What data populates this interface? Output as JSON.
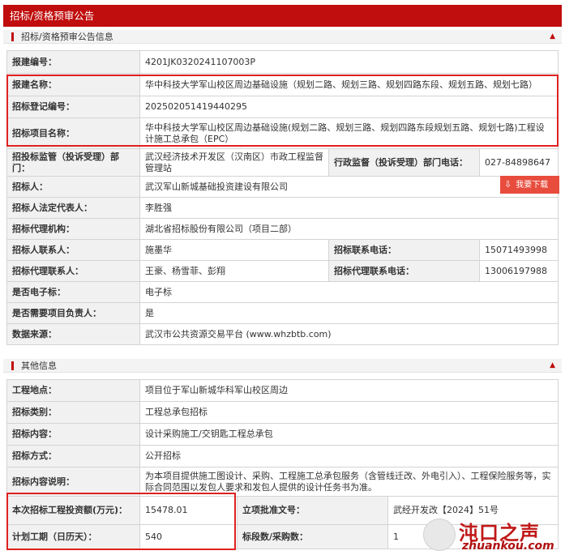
{
  "header": {
    "title": "招标/资格预审公告"
  },
  "section1": {
    "title": "招标/资格预审公告信息",
    "rows": [
      {
        "label": "报建编号：",
        "value": "4201JK0320241107003P"
      },
      {
        "label": "报建名称：",
        "value": "华中科技大学军山校区周边基础设施（规划二路、规划三路、规划四路东段、规划五路、规划七路）"
      },
      {
        "label": "招标登记编号：",
        "value": "202502051419440295"
      },
      {
        "label": "招标项目名称：",
        "value": "华中科技大学军山校区周边基础设施(规划二路、规划三路、规划四路东段规划五路、规划七路)工程设计施工总承包（EPC）"
      },
      {
        "label": "招投标监管（投诉受理）部门：",
        "value": "武汉经济技术开发区（汉南区）市政工程监督管理站",
        "label2": "行政监督（投诉受理）部门电话：",
        "value2": "027-84898647"
      },
      {
        "label": "招标人：",
        "value": "武汉军山新城基础投资建设有限公司"
      },
      {
        "label": "招标人法定代表人：",
        "value": "李胜强"
      },
      {
        "label": "招标代理机构：",
        "value": "湖北省招标股份有限公司（项目二部）"
      },
      {
        "label": "招标人联系人：",
        "value": "施墨华",
        "label2": "招标联系电话：",
        "value2": "15071493998"
      },
      {
        "label": "招标代理联系人：",
        "value": "王豪、杨雪菲、彭翔",
        "label2": "招标代理联系电话：",
        "value2": "13006197988"
      },
      {
        "label": "是否电子标：",
        "value": "电子标"
      },
      {
        "label": "是否需要项目负责人：",
        "value": "是"
      },
      {
        "label": "数据来源：",
        "value": "武汉市公共资源交易平台 (www.whzbtb.com)"
      }
    ]
  },
  "download": {
    "label": "我要下载",
    "icon": "download-icon"
  },
  "section2": {
    "title": "其他信息",
    "rows": [
      {
        "label": "工程地点：",
        "value": "项目位于军山新城华科军山校区周边"
      },
      {
        "label": "招标类别：",
        "value": "工程总承包招标"
      },
      {
        "label": "招标内容：",
        "value": "设计采购施工/交钥匙工程总承包"
      },
      {
        "label": "招标方式：",
        "value": "公开招标"
      },
      {
        "label": "招标内容说明：",
        "value": "为本项目提供施工图设计、采购、工程施工总承包服务（含管线迁改、外电引入）、工程保险服务等，实际合同范围以发包人要求和发包人提供的设计任务书为准。"
      },
      {
        "label": "本次招标工程投资额(万元)：",
        "value": "15478.01",
        "label2": "立项批准文号：",
        "value2": "武经开发改【2024】51号"
      },
      {
        "label": "计划工期（日历天）：",
        "value": "540",
        "label2": "标段数/采购数：",
        "value2": "1"
      }
    ]
  },
  "watermark": {
    "logo": "沌口之声",
    "url": "zhuankou.com"
  },
  "colors": {
    "brand": "#c00d0d",
    "highlight": "#e02020"
  }
}
